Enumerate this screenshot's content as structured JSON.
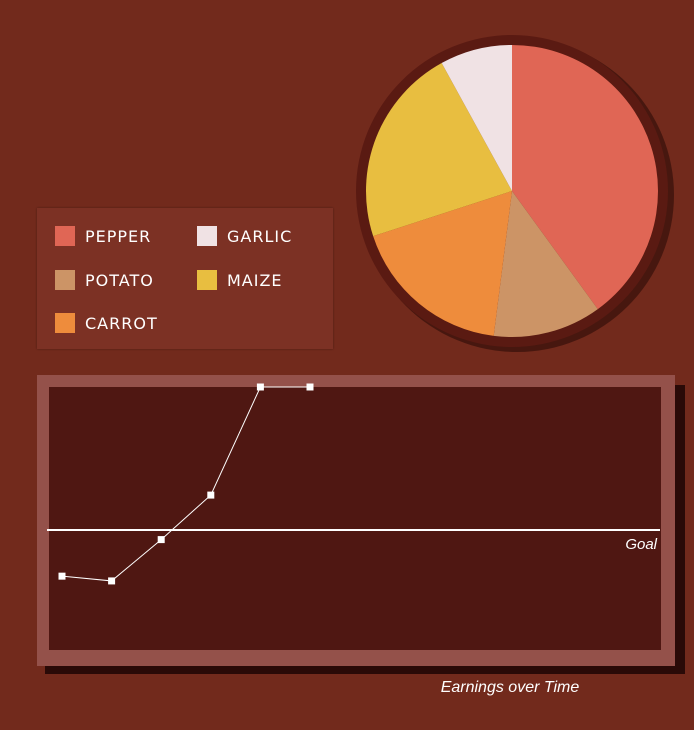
{
  "colors": {
    "background": "#722a1c",
    "legend_bg": "#7c3124",
    "plot_frame": "#94514a",
    "plot_bg": "#4f1712",
    "line": "#ffffff"
  },
  "chart_data": [
    {
      "type": "pie",
      "slices": [
        {
          "name": "PEPPER",
          "value": 40,
          "color": "#e06655"
        },
        {
          "name": "POTATO",
          "value": 12,
          "color": "#cc9466"
        },
        {
          "name": "CARROT",
          "value": 18,
          "color": "#ee8c3c"
        },
        {
          "name": "MAIZE",
          "value": 22,
          "color": "#e8be40"
        },
        {
          "name": "GARLIC",
          "value": 8,
          "color": "#f0e2e4"
        }
      ],
      "legend": {
        "placement": "left",
        "items": [
          {
            "label": "PEPPER",
            "color": "#e06655"
          },
          {
            "label": "GARLIC",
            "color": "#f0e2e4"
          },
          {
            "label": "POTATO",
            "color": "#cc9466"
          },
          {
            "label": "MAIZE",
            "color": "#e8be40"
          },
          {
            "label": "CARROT",
            "color": "#ee8c3c"
          }
        ]
      }
    },
    {
      "type": "line",
      "title": "Earnings over Time",
      "x": [
        1,
        2,
        3,
        4,
        5,
        6
      ],
      "series": [
        {
          "values": [
            15,
            12,
            38,
            66,
            134,
            134
          ]
        }
      ],
      "ylim": [
        0,
        134
      ],
      "goal": {
        "label": "Goal",
        "value": 44
      },
      "grid": false
    }
  ]
}
